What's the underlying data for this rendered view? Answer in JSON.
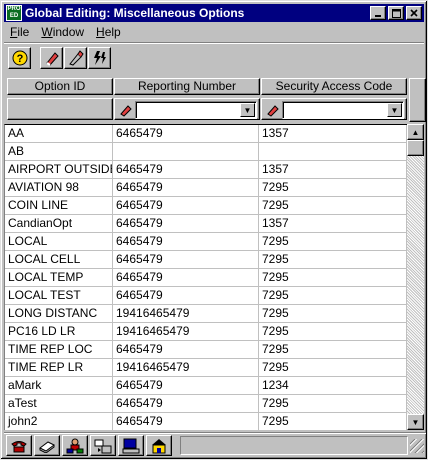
{
  "window": {
    "title": "Global Editing: Miscellaneous Options",
    "icon_text": "ProEdit"
  },
  "menu": [
    {
      "label": "File"
    },
    {
      "label": "Window"
    },
    {
      "label": "Help"
    }
  ],
  "toolbar": {
    "icons": [
      "help-icon",
      "eraser-icon",
      "edit-icon",
      "lightning-icon"
    ]
  },
  "grid": {
    "columns": [
      "Option ID",
      "Reporting Number",
      "Security Access Code"
    ],
    "filters": [
      "",
      ""
    ],
    "rows": [
      [
        "AA",
        "6465479",
        "1357"
      ],
      [
        "AB",
        "",
        ""
      ],
      [
        "AIRPORT OUTSIDE",
        "6465479",
        "1357"
      ],
      [
        "AVIATION 98",
        "6465479",
        "7295"
      ],
      [
        "COIN LINE",
        "6465479",
        "7295"
      ],
      [
        "CandianOpt",
        "6465479",
        "1357"
      ],
      [
        "LOCAL",
        "6465479",
        "7295"
      ],
      [
        "LOCAL CELL",
        "6465479",
        "7295"
      ],
      [
        "LOCAL TEMP",
        "6465479",
        "7295"
      ],
      [
        "LOCAL TEST",
        "6465479",
        "7295"
      ],
      [
        "LONG DISTANC",
        "19416465479",
        "7295"
      ],
      [
        "PC16 LD LR",
        "19416465479",
        "7295"
      ],
      [
        "TIME REP LOC",
        "6465479",
        "7295"
      ],
      [
        "TIME REP LR",
        "19416465479",
        "7295"
      ],
      [
        "aMark",
        "6465479",
        "1234"
      ],
      [
        "aTest",
        "6465479",
        "7295"
      ],
      [
        "john2",
        "6465479",
        "7295"
      ]
    ]
  },
  "bottom_toolbar": {
    "icons": [
      "phone-icon",
      "book-icon",
      "users-icon",
      "transfer-icon",
      "computer-icon",
      "building-icon"
    ]
  },
  "colors": {
    "titlebar": "#000080",
    "face": "#c0c0c0"
  }
}
